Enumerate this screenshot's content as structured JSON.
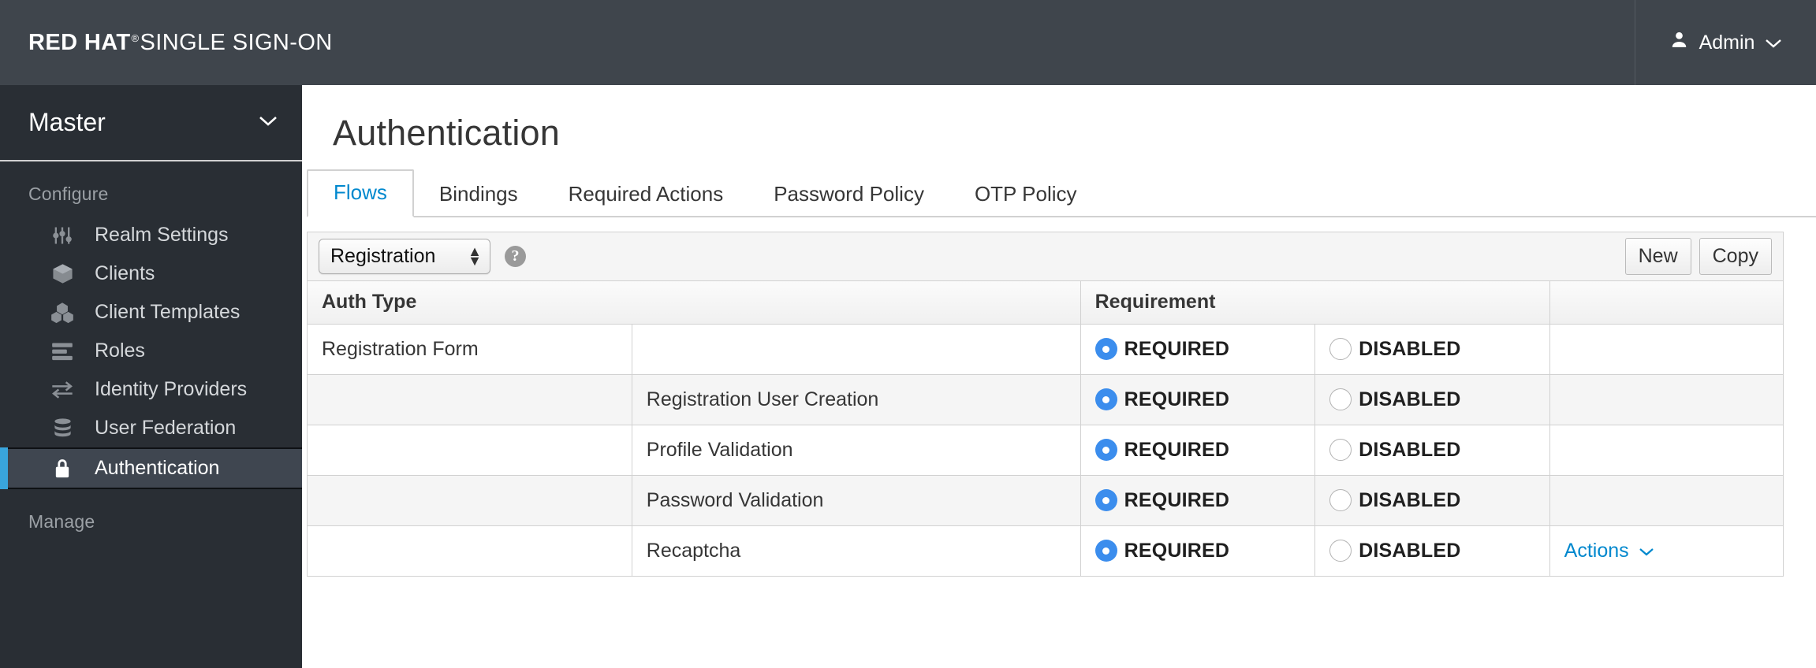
{
  "masthead": {
    "brand_bold": "RED HAT",
    "brand_reg": "®",
    "brand_light": "SINGLE SIGN-ON",
    "user_label": "Admin",
    "person_icon": "person-icon",
    "chevron_icon": "chevron-down-icon"
  },
  "sidebar": {
    "realm": "Master",
    "realm_chevron": "chevron-down-icon",
    "sections": [
      {
        "label": "Configure",
        "items": [
          {
            "label": "Realm Settings",
            "icon": "sliders-icon",
            "active": false
          },
          {
            "label": "Clients",
            "icon": "cube-icon",
            "active": false
          },
          {
            "label": "Client Templates",
            "icon": "cubes-icon",
            "active": false
          },
          {
            "label": "Roles",
            "icon": "list-icon",
            "active": false
          },
          {
            "label": "Identity Providers",
            "icon": "exchange-icon",
            "active": false
          },
          {
            "label": "User Federation",
            "icon": "database-icon",
            "active": false
          },
          {
            "label": "Authentication",
            "icon": "lock-icon",
            "active": true
          }
        ]
      },
      {
        "label": "Manage",
        "items": []
      }
    ]
  },
  "main": {
    "page_title": "Authentication",
    "tabs": [
      {
        "label": "Flows",
        "active": true
      },
      {
        "label": "Bindings",
        "active": false
      },
      {
        "label": "Required Actions",
        "active": false
      },
      {
        "label": "Password Policy",
        "active": false
      },
      {
        "label": "OTP Policy",
        "active": false
      }
    ],
    "toolbar": {
      "flow_select_value": "Registration",
      "help_icon": "help-circle-icon",
      "new_label": "New",
      "copy_label": "Copy"
    },
    "table": {
      "headers": {
        "auth_type": "Auth Type",
        "requirement": "Requirement",
        "blank": ""
      },
      "required_label": "REQUIRED",
      "disabled_label": "DISABLED",
      "actions_label": "Actions",
      "actions_chevron": "chevron-down-icon",
      "rows": [
        {
          "col1": "Registration Form",
          "col2": "",
          "required": true,
          "disabled": false,
          "actions": false
        },
        {
          "col1": "",
          "col2": "Registration User Creation",
          "required": true,
          "disabled": false,
          "actions": false
        },
        {
          "col1": "",
          "col2": "Profile Validation",
          "required": true,
          "disabled": false,
          "actions": false
        },
        {
          "col1": "",
          "col2": "Password Validation",
          "required": true,
          "disabled": false,
          "actions": false
        },
        {
          "col1": "",
          "col2": "Recaptcha",
          "required": true,
          "disabled": false,
          "actions": true
        }
      ]
    }
  },
  "colors": {
    "masthead_bg": "#3f454c",
    "sidebar_bg": "#292e34",
    "active_accent": "#39a5dc",
    "link_blue": "#0088ce",
    "radio_blue": "#3b8ded"
  }
}
